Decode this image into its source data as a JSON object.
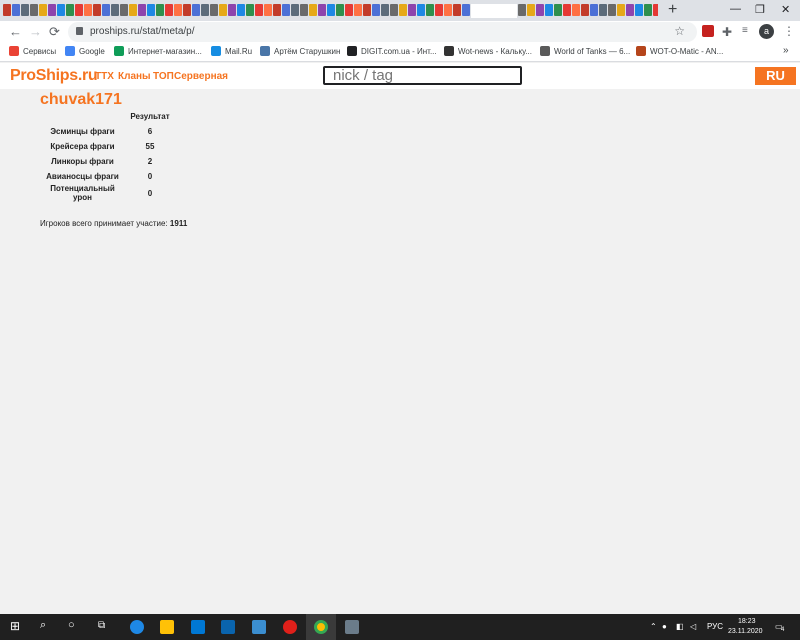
{
  "browser": {
    "url": "proships.ru/stat/meta/p/",
    "profile_initial": "a",
    "new_tab": "+",
    "controls": {
      "minimize": "—",
      "restore": "❐",
      "close": "✕"
    },
    "bookmarks": [
      {
        "label": "Сервисы",
        "color": "#ea4335"
      },
      {
        "label": "Google",
        "color": "#4285f4"
      },
      {
        "label": "Интернет-магазин...",
        "color": "#0f9d58"
      },
      {
        "label": "Mail.Ru",
        "color": "#168de2"
      },
      {
        "label": "Артём Старушкин",
        "color": "#4a76a8"
      },
      {
        "label": "DIGIT.com.ua - Инт...",
        "color": "#202124"
      },
      {
        "label": "Wot-news - Кальку...",
        "color": "#333333"
      },
      {
        "label": "World of Tanks — 6...",
        "color": "#5a5a5a"
      },
      {
        "label": "WOT-O-Matic - AN...",
        "color": "#b5451b"
      }
    ]
  },
  "site": {
    "logo": "ProShips.ru",
    "nav": [
      "ТТХ",
      "Кланы",
      "ТОП",
      "Серверная"
    ],
    "search_placeholder": "nick / tag",
    "lang": "RU"
  },
  "player": {
    "name": "chuvak171",
    "column_header": "Результат",
    "rows": [
      {
        "label": "Эсминцы фраги",
        "value": "6"
      },
      {
        "label": "Крейсера фраги",
        "value": "55"
      },
      {
        "label": "Линкоры фраги",
        "value": "2"
      },
      {
        "label": "Авианосцы фраги",
        "value": "0"
      },
      {
        "label": "Потенциальный урон",
        "value": "0"
      }
    ],
    "total_label": "Игроков всего принимает участие:",
    "total_value": "1911"
  },
  "taskbar": {
    "lang": "РУС",
    "time": "18:23",
    "date": "23.11.2020",
    "notifications": "4"
  }
}
